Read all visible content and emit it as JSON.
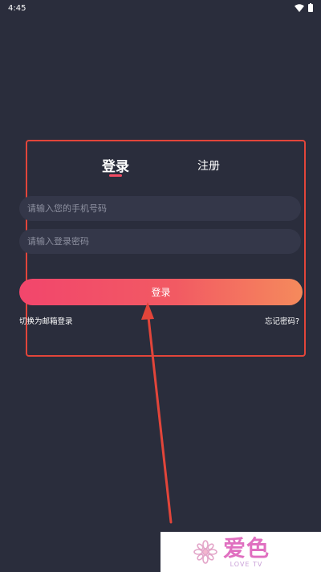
{
  "status_bar": {
    "time": "4:45"
  },
  "tabs": {
    "login": "登录",
    "register": "注册"
  },
  "form": {
    "phone_placeholder": "请输入您的手机号码",
    "password_placeholder": "请输入登录密码",
    "login_button": "登录",
    "switch_link": "切换为邮箱登录",
    "forgot_link": "忘记密码?"
  },
  "watermark": {
    "main": "爱色",
    "sub": "LOVE TV"
  },
  "colors": {
    "background": "#2a2d3c",
    "input_bg": "#343749",
    "accent": "#f24a62",
    "annotation": "#e2453a"
  }
}
